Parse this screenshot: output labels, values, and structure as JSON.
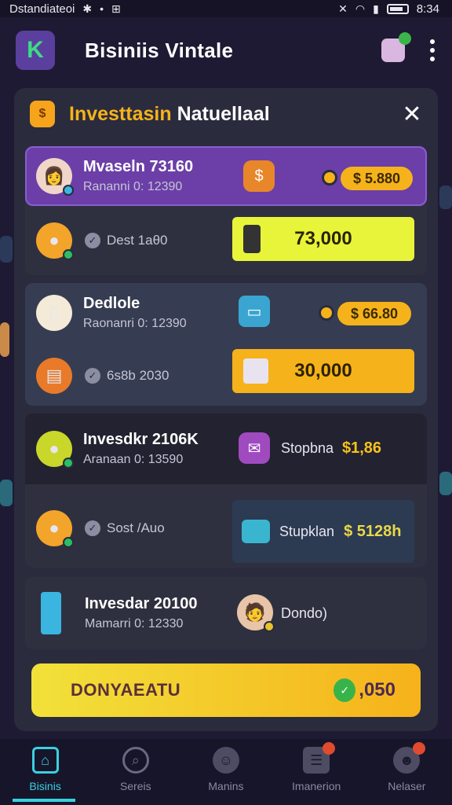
{
  "status_bar": {
    "carrier": "Dstandiateoi",
    "time": "8:34"
  },
  "app_bar": {
    "title": "Bisiniis Vintale"
  },
  "panel": {
    "title_accent": "Investtasin",
    "title_rest": "Natuellaal",
    "cards": [
      {
        "name": "Mvaseln 73160",
        "subtitle": "Rananni 0: 12390",
        "pill_value": "$ 5.880",
        "status_label": "Dest 1aθ0",
        "button_value": "73,000"
      },
      {
        "name": "Dedlole",
        "subtitle": "Raonanri 0: 12390",
        "pill_value": "$ 66.80",
        "status_label": "6s8b 2030",
        "button_value": "30,000"
      },
      {
        "name": "Invesdkr 2106K",
        "subtitle": "Aranaan 0: 13590",
        "right_label": "Stopbna",
        "right_value": "$1,86",
        "status_label": "Sost /Auo",
        "box_label": "Stupklan",
        "box_value": "$ 5128h"
      },
      {
        "name": "Invesdar 20100",
        "subtitle": "Mamarri 0: 12330",
        "right_label": "Dondo)"
      }
    ],
    "cta": {
      "label": "DONYAEATU",
      "value": ",050"
    }
  },
  "bottom_nav": [
    {
      "label": "Bisinis",
      "active": true
    },
    {
      "label": "Sereis",
      "active": false
    },
    {
      "label": "Manins",
      "active": false
    },
    {
      "label": "Imanerion",
      "active": false
    },
    {
      "label": "Nelaser",
      "active": false
    }
  ],
  "colors": {
    "accent_gold": "#f6b21b",
    "lime": "#e8f43a",
    "purple_card": "#6b3fa7",
    "teal_active": "#3ad0e0"
  }
}
